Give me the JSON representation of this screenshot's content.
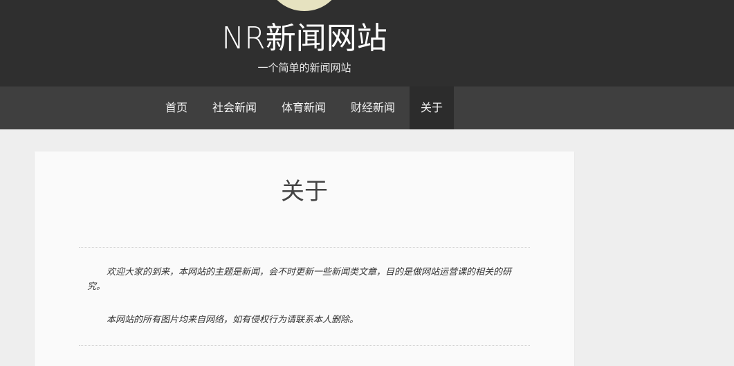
{
  "header": {
    "site_title": "NR新闻网站",
    "site_description": "一个简单的新闻网站",
    "background_color": "#2f2f2f"
  },
  "nav": {
    "items": [
      {
        "label": "首页"
      },
      {
        "label": "社会新闻"
      },
      {
        "label": "体育新闻"
      },
      {
        "label": "财经新闻"
      },
      {
        "label": "关于",
        "active": true
      }
    ]
  },
  "main": {
    "title": "关于",
    "paragraphs": [
      "欢迎大家的到来，本网站的主题是新闻，会不时更新一些新闻类文章，目的是做网站运营课的相关的研究。",
      "本网站的所有图片均来自网络，如有侵权行为请联系本人删除。"
    ]
  }
}
